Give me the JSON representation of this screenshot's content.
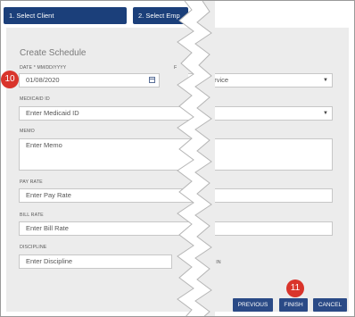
{
  "steps": [
    {
      "label": "1. Select Client"
    },
    {
      "label": "2. Select Emp"
    }
  ],
  "form": {
    "title": "Create Schedule",
    "date_label": "DATE *",
    "date_format": "MM/DD/YYYY",
    "date_value": "01/08/2020",
    "service_partial_label": "F",
    "service_placeholder": "ect Service",
    "medicaid_label": "MEDICAID ID",
    "medicaid_placeholder": "Enter Medicaid ID",
    "memo_label": "MEMO",
    "memo_placeholder": "Enter Memo",
    "pay_rate_label": "PAY RATE",
    "pay_rate_placeholder": "Enter Pay Rate",
    "bill_rate_label": "BILL RATE",
    "bill_rate_placeholder": "Enter Bill Rate",
    "discipline_label": "DISCIPLINE",
    "discipline_placeholder": "Enter Discipline",
    "partial_right_label": "R IN"
  },
  "badges": {
    "date": "10",
    "finish": "11"
  },
  "buttons": {
    "previous": "PREVIOUS",
    "finish": "FINISH",
    "cancel": "CANCEL"
  },
  "colors": {
    "nav": "#1b3f7a",
    "button": "#2a4a86",
    "badge": "#d9342b",
    "panel": "#ececec"
  }
}
